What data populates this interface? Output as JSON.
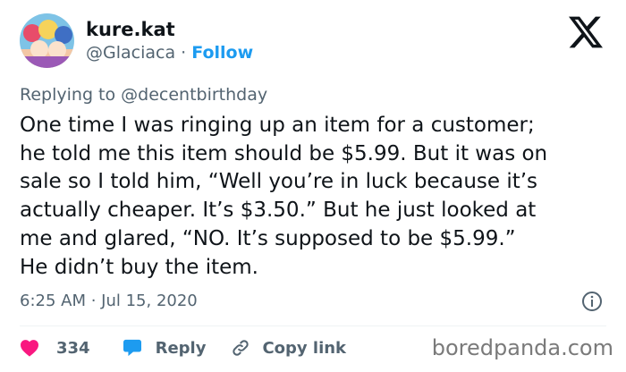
{
  "user": {
    "display_name": "kure.kat",
    "handle": "@Glaciaca",
    "separator": "·",
    "follow_label": "Follow"
  },
  "replying_to": "Replying to @decentbirthday",
  "tweet": {
    "lines": [
      "One time I was ringing up an item for a customer;",
      "he told me this item should be $5.99. But it was on",
      "sale so I told him, “Well you’re in luck because it’s",
      "actually cheaper. It’s $3.50.” But he just looked at",
      "me and glared, “NO. It’s supposed to be $5.99.”",
      "He didn’t buy the item."
    ]
  },
  "timestamp": "6:25 AM · Jul 15, 2020",
  "actions": {
    "like_count": "334",
    "reply_label": "Reply",
    "copy_link_label": "Copy link"
  },
  "watermark": "boredpanda.com",
  "icons": {
    "logo": "x-logo-icon",
    "info": "info-icon",
    "like": "heart-icon",
    "reply": "speech-bubble-icon",
    "copy_link": "link-icon"
  },
  "colors": {
    "text": "#0f1419",
    "secondary": "#536471",
    "accent": "#1d9bf0",
    "like": "#f91880"
  }
}
